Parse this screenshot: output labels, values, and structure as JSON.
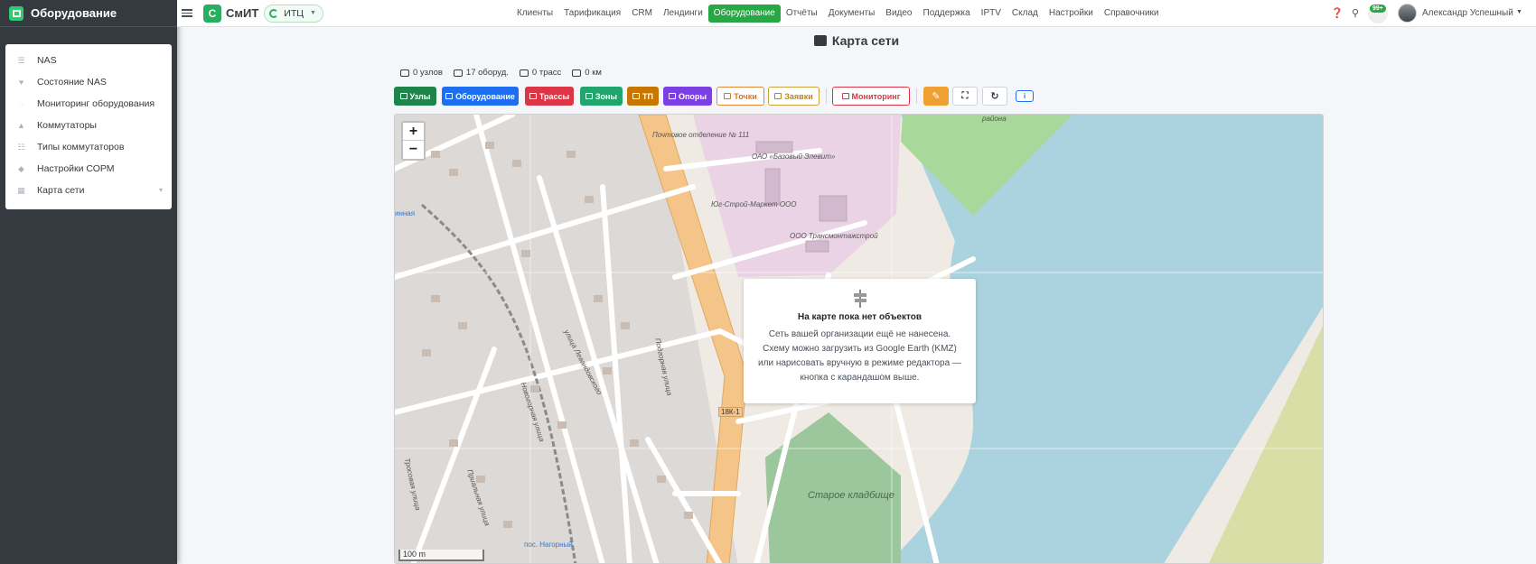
{
  "sidebar": {
    "brand": "Оборудование",
    "items": [
      {
        "label": "NAS",
        "icon": "network-icon"
      },
      {
        "label": "Состояние NAS",
        "icon": "heart-pulse-icon"
      },
      {
        "label": "Мониторинг оборудования",
        "icon": "satellite-icon"
      },
      {
        "label": "Коммутаторы",
        "icon": "router-icon"
      },
      {
        "label": "Типы коммутаторов",
        "icon": "sitemap-icon"
      },
      {
        "label": "Настройки СОРМ",
        "icon": "shield-icon"
      },
      {
        "label": "Карта сети",
        "icon": "map-icon"
      }
    ]
  },
  "topbar": {
    "logo_letter": "С",
    "logo_text": "СмИТ",
    "org": "ИТЦ",
    "menu": [
      "Клиенты",
      "Тарификация",
      "CRM",
      "Лендинги",
      "Оборудование",
      "Отчёты",
      "Документы",
      "Видео",
      "Поддержка",
      "IPTV",
      "Склад",
      "Настройки",
      "Справочники"
    ],
    "active_menu": "Оборудование",
    "notifications_badge": "99+",
    "user_name": "Александр Успешный"
  },
  "page": {
    "title": "Карта сети"
  },
  "stats": [
    {
      "label": "0 узлов",
      "icon": "nodes-icon"
    },
    {
      "label": "17 оборуд.",
      "icon": "equipment-icon"
    },
    {
      "label": "0 трасс",
      "icon": "route-icon"
    },
    {
      "label": "0 км",
      "icon": "ruler-icon"
    }
  ],
  "toolbar": {
    "layers": [
      {
        "label": "Узлы",
        "color": "#1e8449"
      },
      {
        "label": "Оборудование",
        "color": "#1d6ef0"
      },
      {
        "label": "Трассы",
        "color": "#dc3545"
      },
      {
        "label": "Зоны",
        "color": "#20a56d"
      },
      {
        "label": "ТП",
        "color": "#c77700"
      },
      {
        "label": "Опоры",
        "color": "#7b3fe4"
      }
    ],
    "points": "Точки",
    "orders": "Заявки",
    "monitoring": "Мониторинг",
    "accent_orange": "#f0a030",
    "accent_red": "#dc3545"
  },
  "map": {
    "zoom_in": "+",
    "zoom_out": "−",
    "scale": "100 m",
    "empty_title": "На карте пока нет объектов",
    "empty_text": "Сеть вашей организации ещё не нанесена. Схему можно загрузить из Google Earth (KMZ) или нарисовать вручную в режиме редактора — кнопка с карандашом выше.",
    "labels": {
      "post": "Почтовое отделение № 111",
      "base": "ОАО «Базовый Элевит»",
      "market": "Юг-Строй-Маркет ООО",
      "transmontazh": "ООО Трансмонтажстрой",
      "street_lev": "улица Левандовского",
      "street_nov": "Новогорная улица",
      "street_pod": "Подгорная улица",
      "street_tros": "Тросовая улица",
      "street_pri": "Приальная улица",
      "road": "18К-1",
      "stop": "пос. Нагорный",
      "cemetery": "Старое кладбище",
      "district": "района",
      "west": "инная"
    }
  }
}
